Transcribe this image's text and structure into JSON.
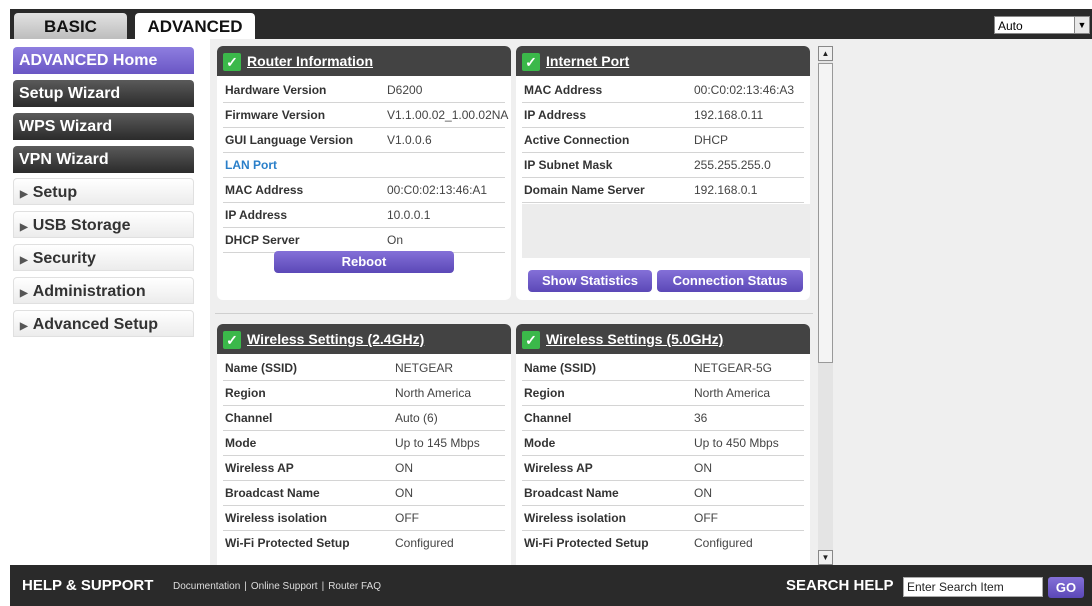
{
  "tabs": {
    "basic": "BASIC",
    "advanced": "ADVANCED"
  },
  "language_select": {
    "value": "Auto"
  },
  "sidebar": {
    "items": [
      {
        "label": "ADVANCED Home",
        "style": "active"
      },
      {
        "label": "Setup Wizard",
        "style": "dark"
      },
      {
        "label": "WPS Wizard",
        "style": "dark"
      },
      {
        "label": "VPN Wizard",
        "style": "dark"
      },
      {
        "label": "Setup",
        "style": "expand"
      },
      {
        "label": "USB Storage",
        "style": "expand"
      },
      {
        "label": "Security",
        "style": "expand"
      },
      {
        "label": "Administration",
        "style": "expand"
      },
      {
        "label": "Advanced Setup",
        "style": "expand"
      }
    ]
  },
  "router_info": {
    "title": "Router Information",
    "rows": [
      {
        "label": "Hardware Version",
        "value": "D6200"
      },
      {
        "label": "Firmware Version",
        "value": "V1.1.00.02_1.00.02NA"
      },
      {
        "label": "GUI Language Version",
        "value": "V1.0.0.6"
      },
      {
        "label": "LAN Port",
        "value": ""
      },
      {
        "label": "MAC Address",
        "value": "00:C0:02:13:46:A1"
      },
      {
        "label": "IP Address",
        "value": "10.0.0.1"
      },
      {
        "label": "DHCP Server",
        "value": "On"
      }
    ],
    "reboot_label": "Reboot"
  },
  "internet_port": {
    "title": "Internet Port",
    "rows": [
      {
        "label": "MAC Address",
        "value": "00:C0:02:13:46:A3"
      },
      {
        "label": "IP Address",
        "value": "192.168.0.11"
      },
      {
        "label": "Active Connection",
        "value": "DHCP"
      },
      {
        "label": "IP Subnet Mask",
        "value": "255.255.255.0"
      },
      {
        "label": "Domain Name Server",
        "value": "192.168.0.1"
      }
    ],
    "show_statistics_label": "Show Statistics",
    "connection_status_label": "Connection Status"
  },
  "wireless_24": {
    "title": "Wireless Settings (2.4GHz)",
    "rows": [
      {
        "label": "Name (SSID)",
        "value": "NETGEAR"
      },
      {
        "label": "Region",
        "value": "North America"
      },
      {
        "label": "Channel",
        "value": "Auto (6)"
      },
      {
        "label": "Mode",
        "value": "Up to 145 Mbps"
      },
      {
        "label": "Wireless AP",
        "value": "ON"
      },
      {
        "label": "Broadcast Name",
        "value": "ON"
      },
      {
        "label": "Wireless isolation",
        "value": "OFF"
      },
      {
        "label": "Wi-Fi Protected Setup",
        "value": "Configured"
      }
    ]
  },
  "wireless_5": {
    "title": "Wireless Settings (5.0GHz)",
    "rows": [
      {
        "label": "Name (SSID)",
        "value": "NETGEAR-5G"
      },
      {
        "label": "Region",
        "value": "North America"
      },
      {
        "label": "Channel",
        "value": "36"
      },
      {
        "label": "Mode",
        "value": "Up to 450 Mbps"
      },
      {
        "label": "Wireless AP",
        "value": "ON"
      },
      {
        "label": "Broadcast Name",
        "value": "ON"
      },
      {
        "label": "Wireless isolation",
        "value": "OFF"
      },
      {
        "label": "Wi-Fi Protected Setup",
        "value": "Configured"
      }
    ]
  },
  "footer": {
    "help_support": "HELP & SUPPORT",
    "documentation": "Documentation",
    "online_support": "Online Support",
    "router_faq": "Router FAQ",
    "search_help": "SEARCH HELP",
    "search_placeholder": "Enter Search Item",
    "go_label": "GO"
  }
}
